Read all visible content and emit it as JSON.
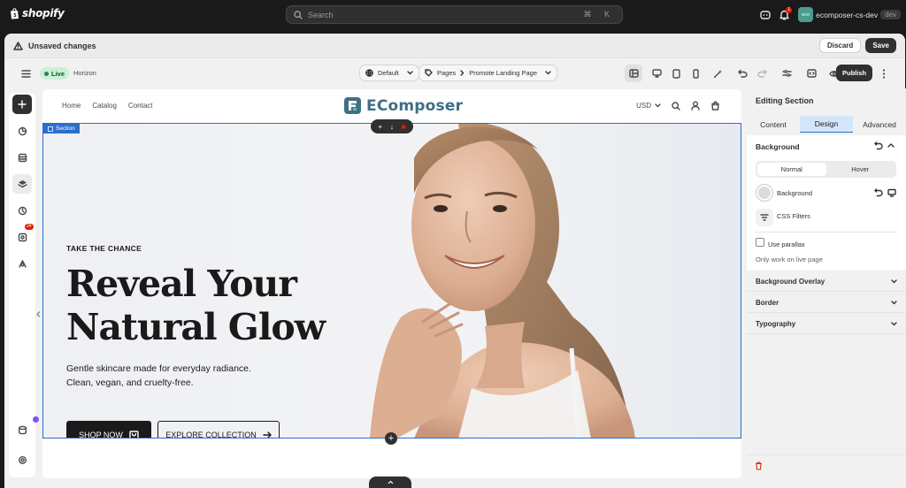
{
  "topbar": {
    "brand": "shopify",
    "search_placeholder": "Search",
    "shortcut": "⌘ K",
    "notification_count": "1",
    "store_initials": "eco",
    "store_name": "ecomposer-cs-dev",
    "store_badge": "dev"
  },
  "unsaved": {
    "message": "Unsaved changes",
    "discard_label": "Discard",
    "save_label": "Save"
  },
  "toolbar": {
    "live_label": "Live",
    "theme_name": "Horizon",
    "template_select": "Default",
    "pages_label": "Pages",
    "page_name": "Promote Landing Page",
    "publish_label": "Publish"
  },
  "rail": {
    "badge_count": "24"
  },
  "store": {
    "nav": [
      "Home",
      "Catalog",
      "Contact"
    ],
    "brand_name": "EComposer",
    "currency": "USD"
  },
  "section": {
    "label": "Section"
  },
  "hero": {
    "kicker": "TAKE THE CHANCE",
    "headline_line1": "Reveal Your",
    "headline_line2": "Natural Glow",
    "subtext_line1": "Gentle skincare made for everyday radiance.",
    "subtext_line2": "Clean, vegan, and cruelty-free.",
    "cta_primary": "SHOP NOW",
    "cta_secondary": "EXPLORE COLLECTION"
  },
  "panel": {
    "title": "Editing Section",
    "tabs": [
      "Content",
      "Design",
      "Advanced"
    ],
    "active_tab": "Design",
    "background": {
      "title": "Background",
      "states": [
        "Normal",
        "Hover"
      ],
      "active_state": "Normal",
      "bg_label": "Background",
      "filters_label": "CSS Filters",
      "parallax_label": "Use parallax",
      "parallax_checked": false,
      "hint": "Only work on live page"
    },
    "sections": [
      "Background Overlay",
      "Border",
      "Typography"
    ]
  },
  "colors": {
    "accent_blue": "#2c6ecb",
    "brand_teal": "#3f6f86",
    "live_green": "#29845a",
    "danger": "#d72c0d"
  }
}
